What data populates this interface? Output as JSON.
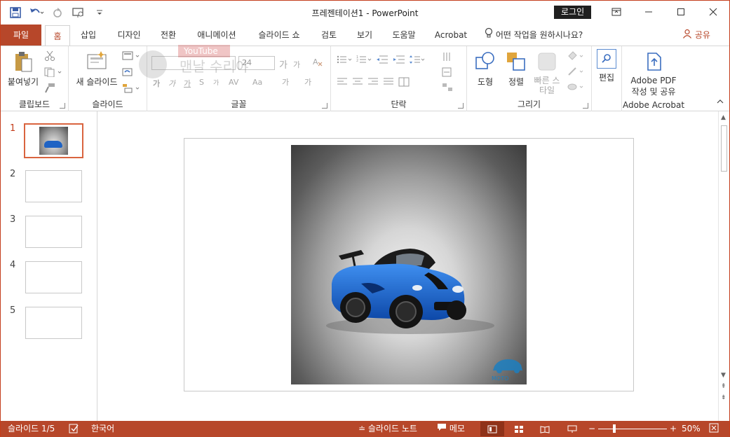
{
  "titlebar": {
    "title": "프레젠테이션1  -  PowerPoint",
    "login": "로그인",
    "qat_icons": [
      "save-icon",
      "undo-icon",
      "redo-icon",
      "present-from-start-icon",
      "customize-qat-icon"
    ]
  },
  "tabs": {
    "file": "파일",
    "items": [
      "홈",
      "삽입",
      "디자인",
      "전환",
      "애니메이션",
      "슬라이드 쇼",
      "검토",
      "보기",
      "도움말",
      "Acrobat"
    ],
    "active": "홈",
    "tellme": "어떤 작업을 원하시나요?",
    "share": "공유"
  },
  "ribbon": {
    "clipboard": {
      "label": "클립보드",
      "paste": "붙여넣기"
    },
    "slides": {
      "label": "슬라이드",
      "new_slide": "새 슬라이드"
    },
    "font": {
      "label": "글꼴",
      "size": "24",
      "grow": "가",
      "shrink": "가",
      "bold": "가",
      "italic": "가",
      "underline": "가",
      "strike": "가",
      "spacing": "AV",
      "case": "Aa",
      "color": "가",
      "highlight": "가"
    },
    "paragraph": {
      "label": "단락"
    },
    "drawing": {
      "label": "그리기",
      "shapes": "도형",
      "arrange": "정렬",
      "quick_styles": "빠른 스타일"
    },
    "editing": {
      "label": "",
      "edit": "편집"
    },
    "acrobat": {
      "label": "Adobe Acrobat",
      "btn_line1": "Adobe PDF",
      "btn_line2": "작성 및 공유"
    }
  },
  "thumbnails": {
    "slides": [
      "1",
      "2",
      "3",
      "4",
      "5"
    ],
    "selected": "1"
  },
  "slide": {
    "image_watermark": "MOTO"
  },
  "statusbar": {
    "slide_info": "슬라이드 1/5",
    "language": "한국어",
    "notes": "슬라이드 노트",
    "comments": "메모",
    "zoom": "50%"
  },
  "colors": {
    "accent": "#b7472a",
    "car_blue": "#1f63c4"
  }
}
